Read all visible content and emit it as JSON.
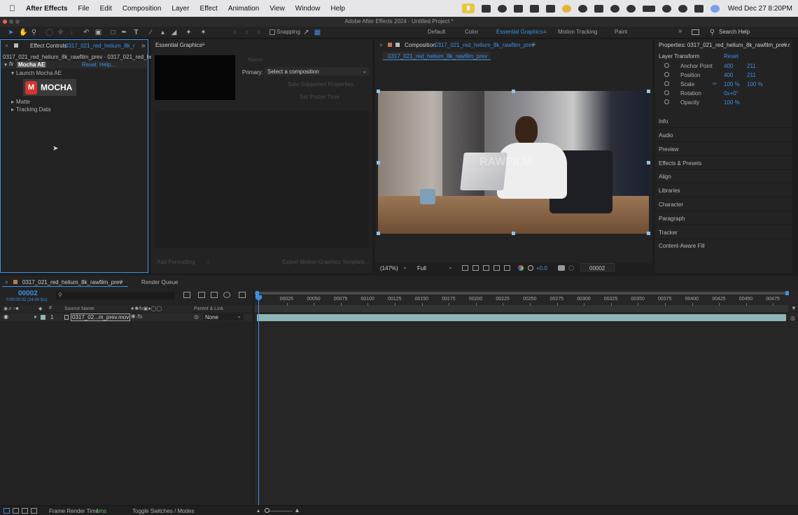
{
  "menubar": {
    "app_name": "After Effects",
    "items": [
      "File",
      "Edit",
      "Composition",
      "Layer",
      "Effect",
      "Animation",
      "View",
      "Window",
      "Help"
    ],
    "clock": "Wed Dec 27  8:20PM"
  },
  "window": {
    "title": "Adobe After Effects 2024 - Untitled Project *"
  },
  "toolbar": {
    "snapping_label": "Snapping",
    "workspaces": [
      "Default",
      "Color",
      "Essential Graphics",
      "Motion Tracking",
      "Paint"
    ],
    "active_workspace": "Essential Graphics",
    "search_placeholder": "Search Help"
  },
  "effect_controls": {
    "tab_label": "Effect Controls",
    "tab_layer": "0317_021_red_helium_8k_r",
    "breadcrumb": "0317_021_red_helium_8k_rawfilm_prev · 0317_021_red_heliu",
    "effect_name": "Mocha AE",
    "reset": "Reset",
    "help": "Help...",
    "launch": "Launch Mocha AE",
    "logo_text": "MOCHA",
    "groups": [
      "Matte",
      "Tracking Data"
    ]
  },
  "essential_graphics": {
    "title": "Essential Graphics",
    "name_label": "Name:",
    "primary_label": "Primary:",
    "primary_value": "Select a composition",
    "solo_btn": "Solo Supported Properties",
    "poster_btn": "Set Poster Time",
    "add_formatting": "Add Formatting",
    "export_btn": "Export Motion Graphics Template..."
  },
  "composition": {
    "tab_prefix": "Composition",
    "comp_name": "0317_021_red_helium_8k_rawfilm_prev",
    "sub_tab": "0317_021_red_helium_8k_rawfilm_prev",
    "watermark": "RAWFILM",
    "zoom": "(147%)",
    "resolution": "Full",
    "exposure": "+0.0",
    "timecode": "00002"
  },
  "properties": {
    "title": "Properties: 0317_021_red_helium_8k_rawfilm_prev.r",
    "layer_transform": "Layer Transform",
    "reset": "Reset",
    "rows": [
      {
        "label": "Anchor Point",
        "v1": "400",
        "v2": "211"
      },
      {
        "label": "Position",
        "v1": "400",
        "v2": "211"
      },
      {
        "label": "Scale",
        "v1": "100 %",
        "v2": "100 %"
      },
      {
        "label": "Rotation",
        "v1": "0x+0°",
        "v2": ""
      },
      {
        "label": "Opacity",
        "v1": "100 %",
        "v2": ""
      }
    ],
    "sections": [
      "Info",
      "Audio",
      "Preview",
      "Effects & Presets",
      "Align",
      "Libraries",
      "Character",
      "Paragraph",
      "Tracker",
      "Content-Aware Fill"
    ]
  },
  "timeline": {
    "tab_label": "0317_021_red_helium_8k_rawfilm_prev",
    "render_queue": "Render Queue",
    "timecode": "00002",
    "timecode_sub": "0:00:00:02 (24.00 fps)",
    "col_source": "Source Name",
    "col_parent": "Parent & Link",
    "layer_num": "1",
    "layer_name": "0317_02...m_prev.mov",
    "parent_value": "None",
    "ruler": [
      "00025",
      "00050",
      "00075",
      "00100",
      "00125",
      "00150",
      "00175",
      "00200",
      "00225",
      "00250",
      "00275",
      "00300",
      "00325",
      "00350",
      "00375",
      "00400",
      "00425",
      "00450",
      "00475"
    ]
  },
  "statusbar": {
    "render_label": "Frame Render Time",
    "render_value": "1ms",
    "toggle": "Toggle Switches / Modes"
  },
  "colors": {
    "accent": "#3d8fe4",
    "panel": "#232323",
    "clip": "#8fb6b6"
  }
}
